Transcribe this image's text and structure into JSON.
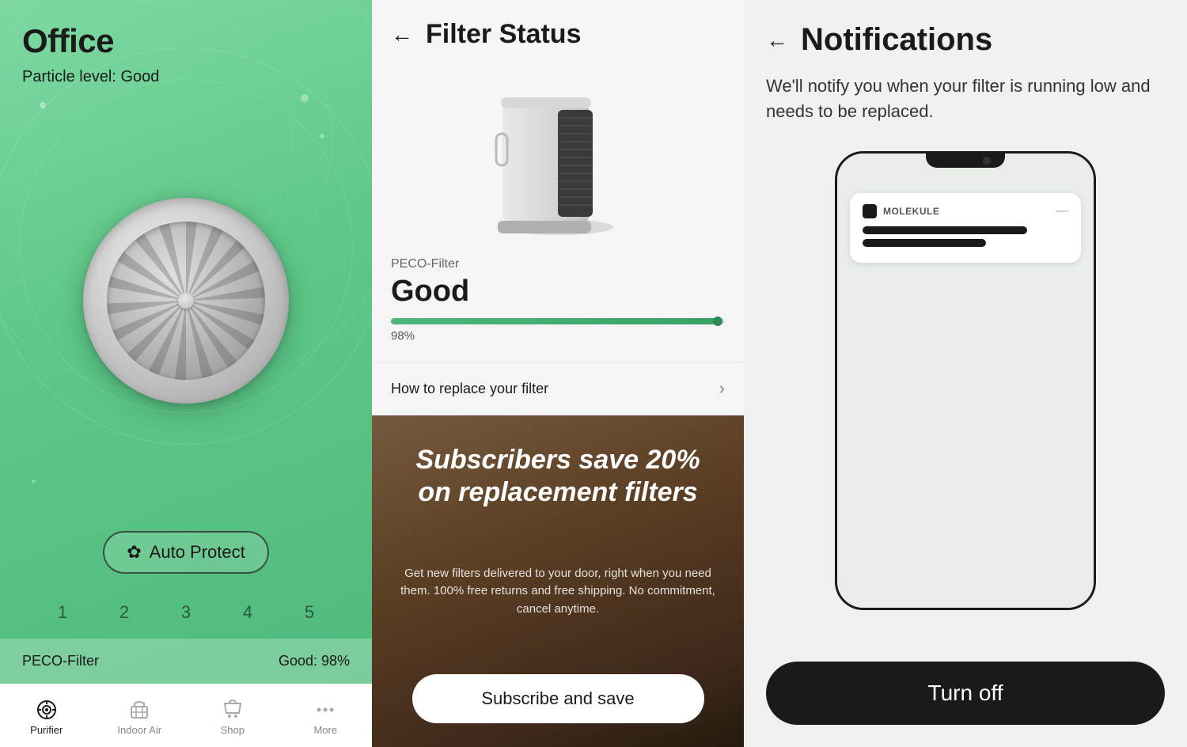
{
  "office": {
    "title": "Office",
    "particle_level": "Particle level: Good",
    "auto_protect_label": "Auto Protect",
    "fan_speeds": [
      "1",
      "2",
      "3",
      "4",
      "5"
    ],
    "filter_label": "PECO-Filter",
    "filter_value": "Good: 98%"
  },
  "filter_status": {
    "back_arrow": "←",
    "title": "Filter Status",
    "filter_type": "PECO-Filter",
    "condition": "Good",
    "percent": "98%",
    "percent_value": 98,
    "replace_link": "How to replace your filter",
    "promo_headline": "Subscribers save 20% on replacement filters",
    "promo_subtext": "Get new filters delivered to your door, right when you need them. 100% free returns and free shipping. No commitment, cancel anytime.",
    "subscribe_label": "Subscribe and save"
  },
  "notifications": {
    "back_arrow": "←",
    "title": "Notifications",
    "description": "We'll notify you when your filter is running low and needs to be replaced.",
    "app_name": "MOLEKULE",
    "notif_minimize": "—",
    "turn_off_label": "Turn off"
  },
  "nav": {
    "items": [
      {
        "label": "Purifier",
        "active": true
      },
      {
        "label": "Indoor Air",
        "active": false
      },
      {
        "label": "Shop",
        "active": false
      },
      {
        "label": "More",
        "active": false
      }
    ]
  }
}
